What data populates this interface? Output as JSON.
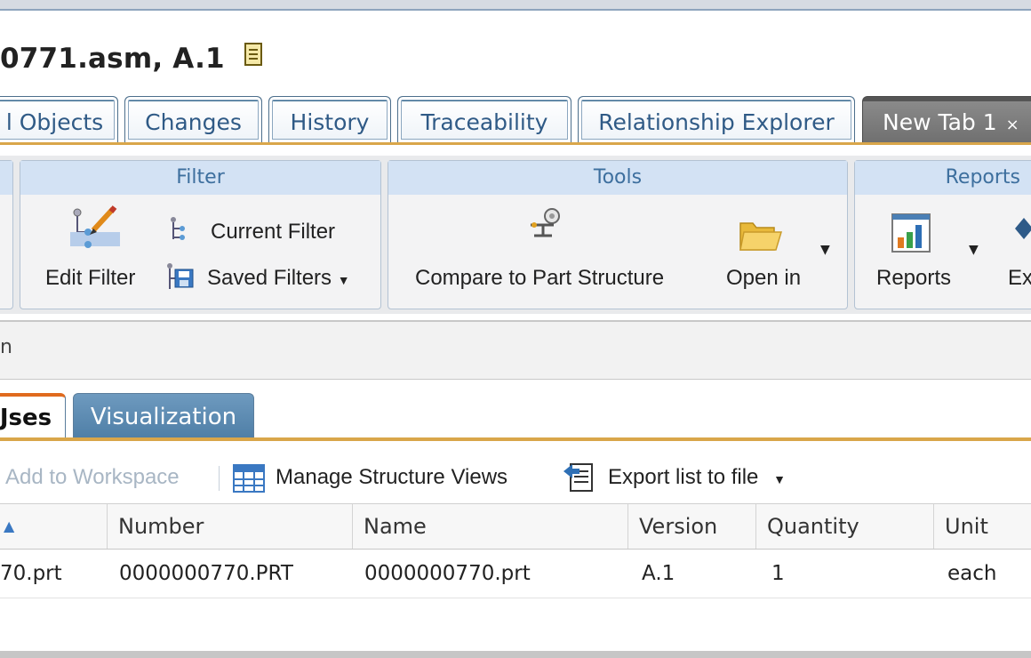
{
  "title": "0771.asm, A.1",
  "main_tabs": [
    {
      "label": "l Objects"
    },
    {
      "label": "Changes"
    },
    {
      "label": "History"
    },
    {
      "label": "Traceability"
    },
    {
      "label": "Relationship Explorer"
    },
    {
      "label": "New Tab 1",
      "close": "×",
      "active": true
    }
  ],
  "ribbon": {
    "filter": {
      "header": "Filter",
      "edit_filter": "Edit Filter",
      "current_filter": "Current Filter",
      "saved_filters": "Saved Filters"
    },
    "tools": {
      "header": "Tools",
      "compare": "Compare to Part Structure",
      "open_in": "Open in"
    },
    "reports": {
      "header": "Reports",
      "reports_btn": "Reports",
      "export_partial": "Ex"
    }
  },
  "info_row": {
    "text": "n"
  },
  "sub_tabs": [
    {
      "label": "Jses",
      "active": true
    },
    {
      "label": "Visualization"
    }
  ],
  "toolbar": {
    "add_to_workspace": "Add to Workspace",
    "manage_structure_views": "Manage Structure Views",
    "export_list": "Export list to file"
  },
  "table": {
    "sort_indicator": "▲",
    "columns": [
      "Number",
      "Name",
      "Version",
      "Quantity",
      "Unit"
    ],
    "rows": [
      {
        "first": "70.prt",
        "number": "0000000770.PRT",
        "name": "0000000770.prt",
        "version": "A.1",
        "quantity": "1",
        "unit": "each"
      }
    ]
  },
  "colors": {
    "accent_tab": "#3e6f93",
    "active_tab": "#707070",
    "gold_line": "#d9a64a",
    "ribbon_header": "#d3e2f4",
    "orange_active": "#e06a1e"
  }
}
